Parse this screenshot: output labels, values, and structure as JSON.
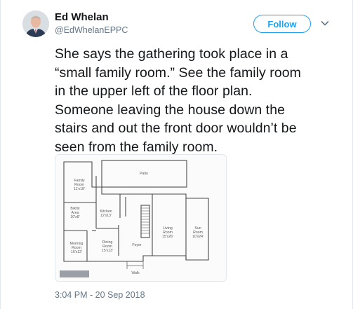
{
  "author": {
    "name": "Ed Whelan",
    "handle": "@EdWhelanEPPC"
  },
  "follow_label": "Follow",
  "tweet_lines": [
    "She says the gathering took place in a",
    "“small family room.” See the family room",
    "in the upper left of the floor plan.",
    "Someone leaving the house down the",
    "stairs and out the front door wouldn’t be",
    "seen from the family room."
  ],
  "floor_plan": {
    "patio": "Patio",
    "family_room": [
      "Family",
      "Room",
      "11'x18'"
    ],
    "bkfst_area": [
      "Brkfst",
      "Area",
      "10'x8'"
    ],
    "kitchen": [
      "Kitchen",
      "12'x13'"
    ],
    "living_room": [
      "Living",
      "Room",
      "15'x26'"
    ],
    "sun_room": [
      "Sun",
      "Room",
      "10'x24'"
    ],
    "morning_room": [
      "Morning",
      "Room",
      "16'x12'"
    ],
    "dining_room": [
      "Dining",
      "Room",
      "15'x13'"
    ],
    "foyer": "Foyer",
    "walk": "Walk"
  },
  "timestamp": "3:04 PM - 20 Sep 2018",
  "icons": {
    "chevron": "chevron-down-icon",
    "avatar": "avatar"
  },
  "colors": {
    "accent": "#1da1f2",
    "secondary_text": "#657786",
    "border": "#e1e8ed"
  }
}
